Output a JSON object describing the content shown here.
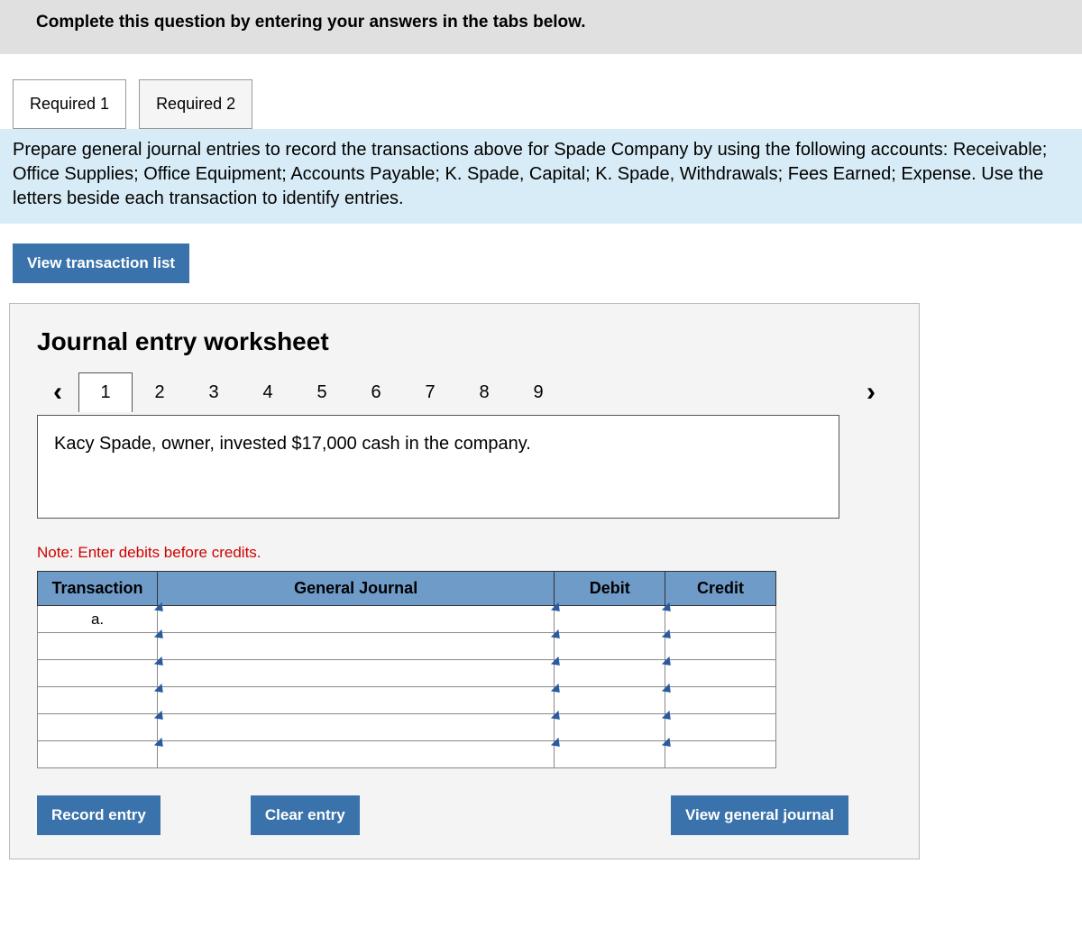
{
  "banner": "Complete this question by entering your answers in the tabs below.",
  "mainTabs": [
    {
      "label": "Required 1",
      "active": true
    },
    {
      "label": "Required 2",
      "active": false
    }
  ],
  "prompt": "Prepare general journal entries to record the transactions above for Spade Company by using the following accounts: Receivable; Office Supplies; Office Equipment; Accounts Payable; K. Spade, Capital; K. Spade, Withdrawals; Fees Earned; Expense. Use the letters beside each transaction to identify entries.",
  "viewTxnListLabel": "View transaction list",
  "worksheet": {
    "title": "Journal entry worksheet",
    "steps": [
      "1",
      "2",
      "3",
      "4",
      "5",
      "6",
      "7",
      "8",
      "9"
    ],
    "activeStep": "1",
    "transactionText": "Kacy Spade, owner, invested $17,000 cash in the company.",
    "note": "Note: Enter debits before credits.",
    "columns": {
      "transaction": "Transaction",
      "generalJournal": "General Journal",
      "debit": "Debit",
      "credit": "Credit"
    },
    "rows": [
      {
        "transaction": "a.",
        "generalJournal": "",
        "debit": "",
        "credit": ""
      },
      {
        "transaction": "",
        "generalJournal": "",
        "debit": "",
        "credit": ""
      },
      {
        "transaction": "",
        "generalJournal": "",
        "debit": "",
        "credit": ""
      },
      {
        "transaction": "",
        "generalJournal": "",
        "debit": "",
        "credit": ""
      },
      {
        "transaction": "",
        "generalJournal": "",
        "debit": "",
        "credit": ""
      },
      {
        "transaction": "",
        "generalJournal": "",
        "debit": "",
        "credit": ""
      }
    ],
    "buttons": {
      "record": "Record entry",
      "clear": "Clear entry",
      "viewJournal": "View general journal"
    }
  }
}
